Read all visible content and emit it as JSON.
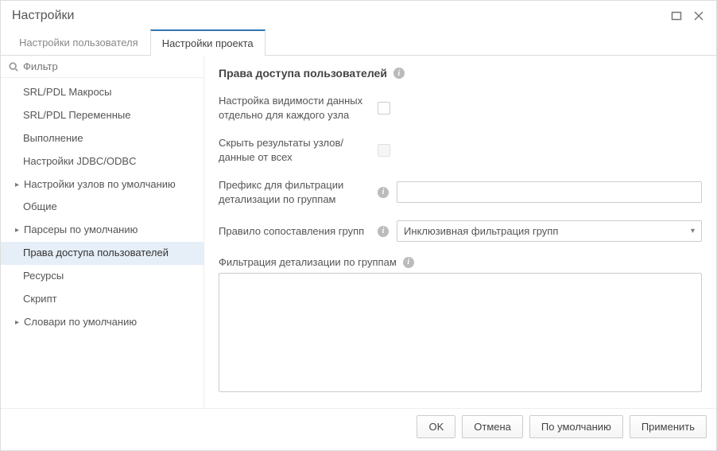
{
  "window": {
    "title": "Настройки"
  },
  "tabs": {
    "user": "Настройки пользователя",
    "project": "Настройки проекта"
  },
  "sidebar": {
    "filter_placeholder": "Фильтр",
    "items": [
      {
        "label": "SRL/PDL Макросы",
        "parent": false
      },
      {
        "label": "SRL/PDL Переменные",
        "parent": false
      },
      {
        "label": "Выполнение",
        "parent": false
      },
      {
        "label": "Настройки JDBC/ODBC",
        "parent": false
      },
      {
        "label": "Настройки узлов по умолчанию",
        "parent": true
      },
      {
        "label": "Общие",
        "parent": false
      },
      {
        "label": "Парсеры по умолчанию",
        "parent": true
      },
      {
        "label": "Права доступа пользователей",
        "parent": false,
        "selected": true
      },
      {
        "label": "Ресурсы",
        "parent": false
      },
      {
        "label": "Скрипт",
        "parent": false
      },
      {
        "label": "Словари по умолчанию",
        "parent": true
      }
    ]
  },
  "panel": {
    "heading": "Права доступа пользователей",
    "rows": {
      "visibility": {
        "label": "Настройка видимости данных отдельно для каждого узла"
      },
      "hide": {
        "label": "Скрыть результаты узлов/данные от всех"
      },
      "prefix": {
        "label": "Префикс для фильтрации детализации по группам",
        "value": ""
      },
      "rule": {
        "label": "Правило сопоставления групп",
        "value": "Инклюзивная фильтрация групп"
      },
      "filter": {
        "label": "Фильтрация детализации по группам"
      }
    }
  },
  "footer": {
    "ok": "OK",
    "cancel": "Отмена",
    "default": "По умолчанию",
    "apply": "Применить"
  }
}
